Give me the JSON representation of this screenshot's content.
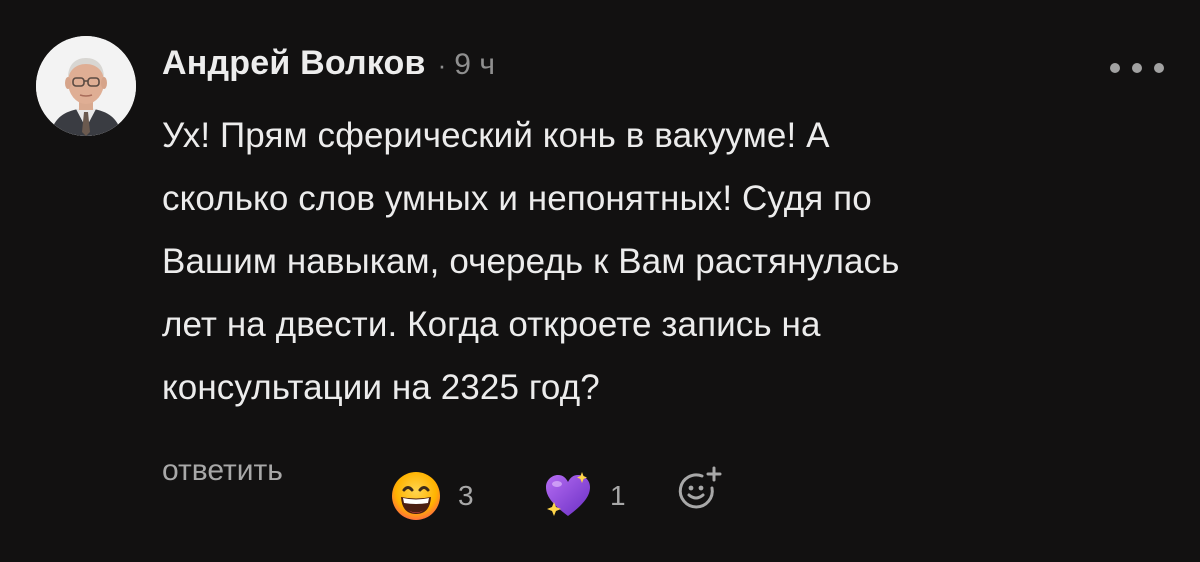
{
  "comment": {
    "author": "Андрей Волков",
    "separator": "·",
    "time": "9 ч",
    "text": "Ух! Прям сферический конь в вакууме! А\nсколько слов умных и непонятных! Судя по\nВашим навыкам, очередь к Вам растянулась\nлет на двести. Когда откроете запись на\nконсультации на 2325 год?",
    "reply_label": "ответить",
    "reactions": [
      {
        "icon": "grinning-face-emoji",
        "count": "3"
      },
      {
        "icon": "purple-sparkling-heart-emoji",
        "count": "1"
      }
    ],
    "add_reaction_icon": "add-reaction-icon",
    "more_icon": "more-options-icon"
  },
  "colors": {
    "background": "#121111",
    "text": "#ececec",
    "muted": "#8f8f8f"
  }
}
